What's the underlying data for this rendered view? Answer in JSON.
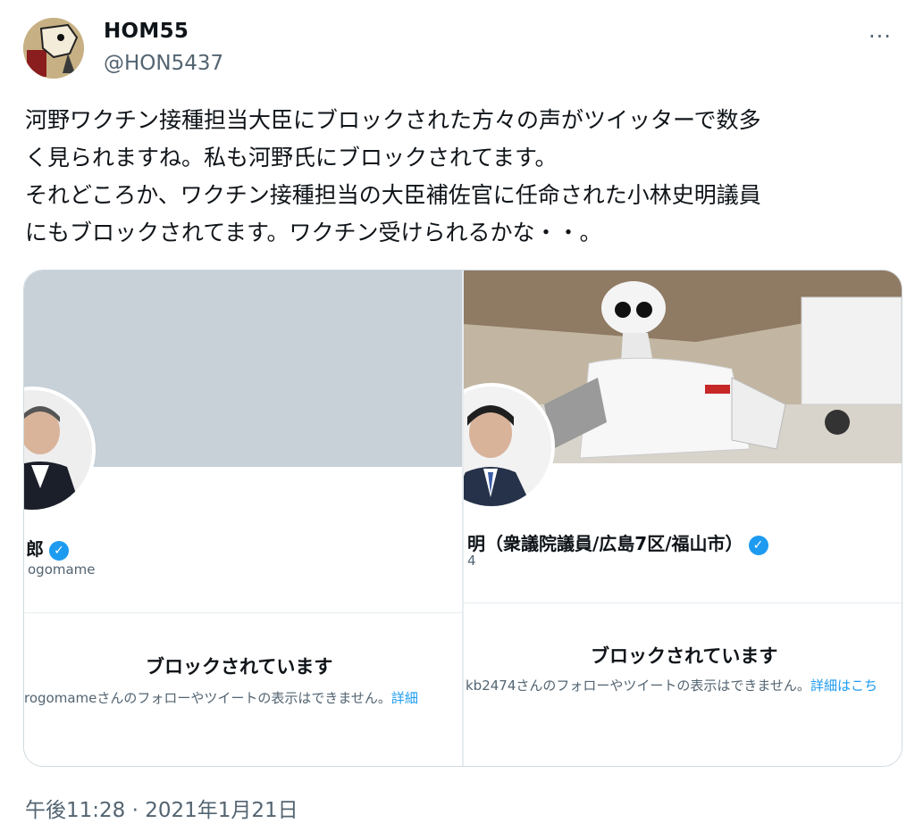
{
  "author": {
    "display_name": "HOM55",
    "handle": "@HON5437"
  },
  "more_icon": "...",
  "tweet": {
    "lines": [
      "河野ワクチン接種担当大臣にブロックされた方々の声がツイッターで数多",
      "く見られますね。私も河野氏にブロックされてます。",
      "それどころか、ワクチン接種担当の大臣補佐官に任命された小林史明議員",
      "にもブロックされてます。ワクチン受けられるかな・・。"
    ],
    "timestamp": "午後11:28 · 2021年1月21日"
  },
  "media": [
    {
      "name_fragment": "郎",
      "handle_fragment": "ogomame",
      "blocked_title": "ブロックされています",
      "blocked_desc": "rogomameさんのフォローやツイートの表示はできません。",
      "details_link": "詳細"
    },
    {
      "name_fragment": "明（衆議院議員/広島7区/福山市）",
      "handle_fragment": "4",
      "blocked_title": "ブロックされています",
      "blocked_desc": "kb2474さんのフォローやツイートの表示はできません。",
      "details_link": "詳細はこち"
    }
  ],
  "colors": {
    "accent": "#1d9bf0",
    "secondary_text": "#536471",
    "banner_gray": "#c8d0d8"
  }
}
